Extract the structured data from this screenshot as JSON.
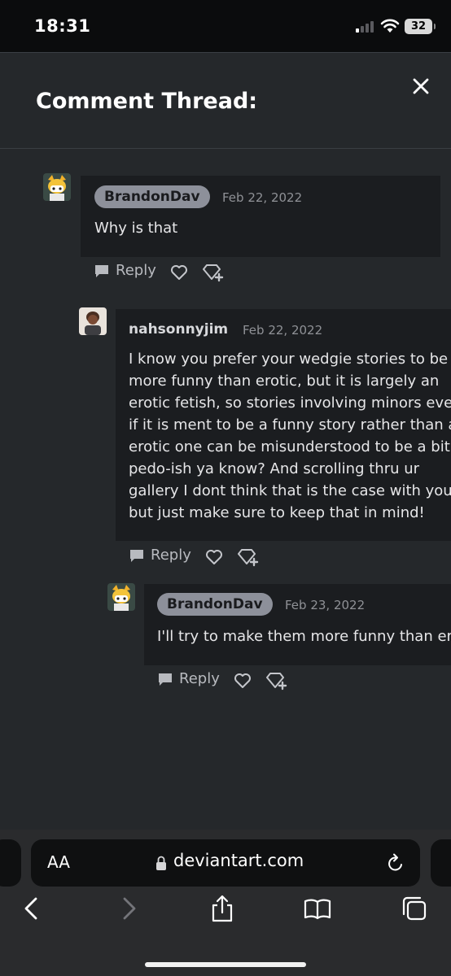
{
  "status_bar": {
    "time": "18:31",
    "battery": "32"
  },
  "modal": {
    "title": "Comment Thread:"
  },
  "comments": [
    {
      "username": "BrandonDav",
      "date": "Feb 22, 2022",
      "lines": [
        "Why is that"
      ],
      "reply_label": "Reply"
    },
    {
      "username": "nahsonnyjim",
      "date": "Feb 22, 2022",
      "lines": [
        "I know you prefer your wedgie stories to be",
        "more funny than erotic, but it is largely an",
        "erotic fetish, so stories involving minors even",
        "if it is ment to be a funny story rather than an",
        "erotic one can be misunderstood to be a bit..",
        "pedo-ish ya know? And scrolling thru ur",
        "gallery I dont think that is the case with you",
        "but just make sure to keep that in mind!"
      ],
      "reply_label": "Reply"
    },
    {
      "username": "BrandonDav",
      "date": "Feb 23, 2022",
      "lines": [
        "I'll try to make them more funny than erotic"
      ],
      "reply_label": "Reply"
    }
  ],
  "browser": {
    "aa_label": "AA",
    "url": "deviantart.com"
  },
  "colors": {
    "modal_bg": "#25282b",
    "comment_bg": "#1b1d20",
    "pill_bg": "#8d909a"
  },
  "icons": [
    "close-icon",
    "reply-bubble-icon",
    "heart-icon",
    "award-icon",
    "lock-icon",
    "reload-icon",
    "back-icon",
    "forward-icon",
    "share-icon",
    "bookmarks-icon",
    "tabs-icon"
  ]
}
